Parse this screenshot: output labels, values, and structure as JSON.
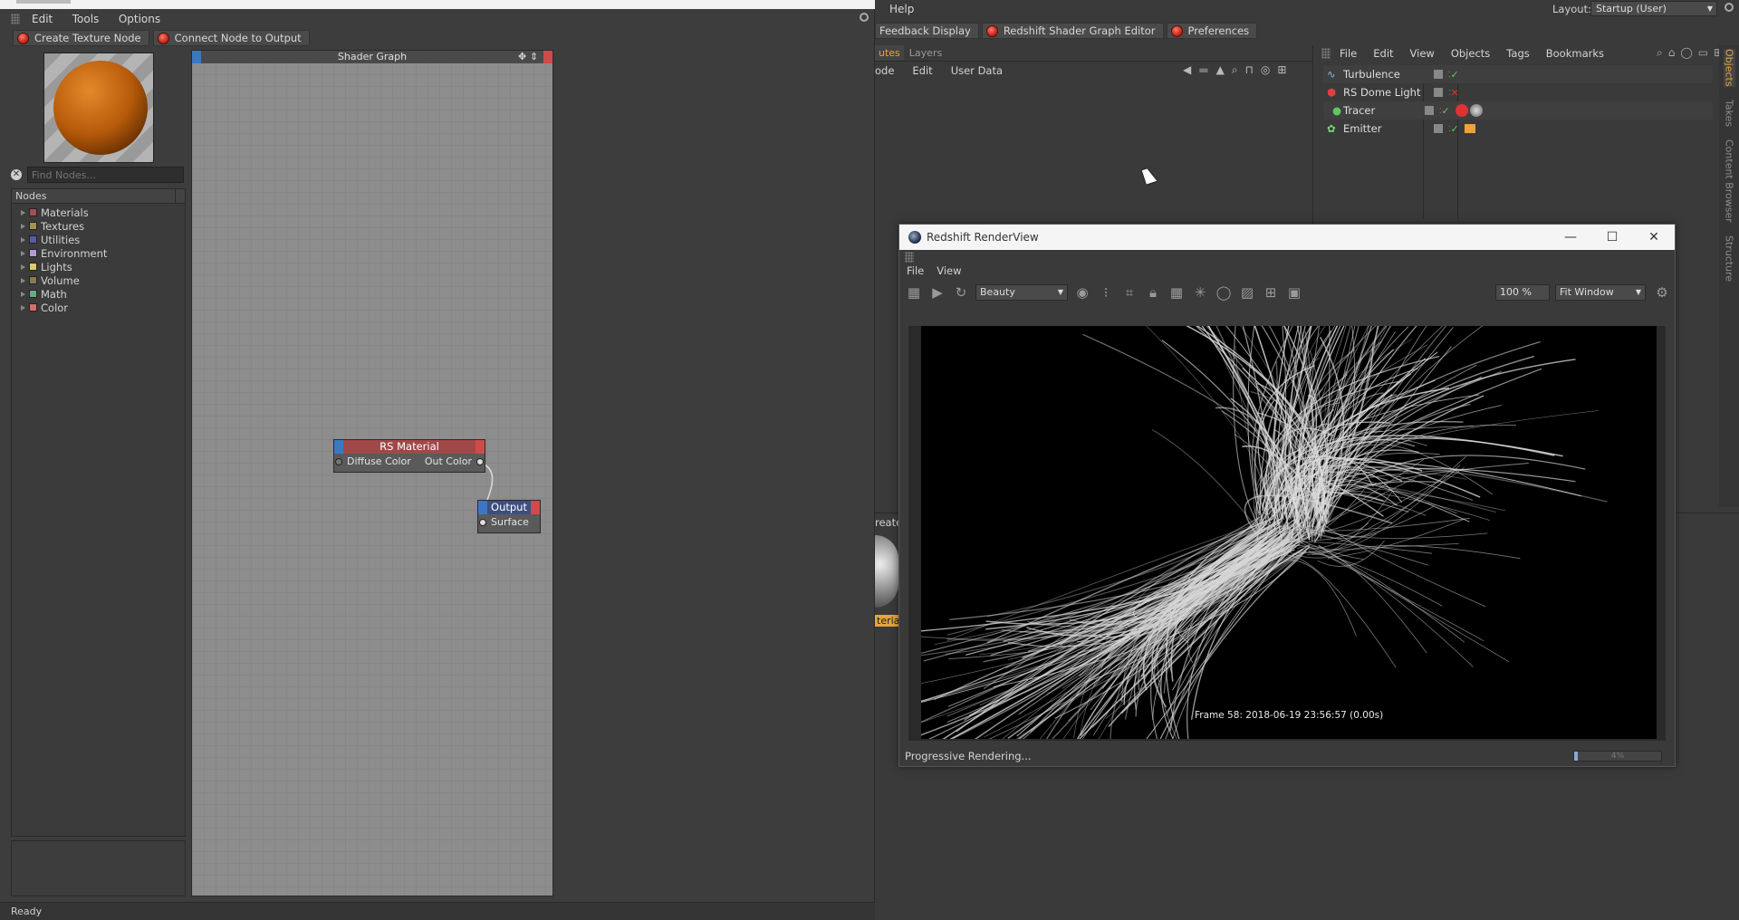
{
  "left_menu": [
    "Edit",
    "Tools",
    "Options"
  ],
  "toolbar": {
    "create_texture": "Create Texture Node",
    "connect_output": "Connect Node to Output"
  },
  "find_nodes": {
    "placeholder": "Find Nodes..."
  },
  "nodes_panel": {
    "header": "Nodes",
    "categories": [
      {
        "label": "Materials",
        "color": "#a05050"
      },
      {
        "label": "Textures",
        "color": "#a09450"
      },
      {
        "label": "Utilities",
        "color": "#5a5aa8"
      },
      {
        "label": "Environment",
        "color": "#b49ad0"
      },
      {
        "label": "Lights",
        "color": "#e0c870"
      },
      {
        "label": "Volume",
        "color": "#857a50"
      },
      {
        "label": "Math",
        "color": "#6aaa80"
      },
      {
        "label": "Color",
        "color": "#d07070"
      }
    ]
  },
  "shader_graph": {
    "title": "Shader Graph",
    "rs_material": {
      "title": "RS Material",
      "in_port": "Diffuse Color",
      "out_port": "Out Color"
    },
    "output": {
      "title": "Output",
      "in_port": "Surface"
    }
  },
  "status_bar": {
    "text": "Ready"
  },
  "top_right": {
    "help": "Help",
    "layout_label": "Layout:",
    "layout_value": "Startup (User)"
  },
  "tabs": {
    "feedback": "Feedback Display",
    "shader_editor": "Redshift Shader Graph Editor",
    "preferences": "Preferences"
  },
  "attributes": {
    "tab_partial": "utes",
    "layers_tab": "Layers",
    "menu": [
      "ode",
      "Edit",
      "User Data"
    ]
  },
  "objects_panel": {
    "menu": [
      "File",
      "Edit",
      "View",
      "Objects",
      "Tags",
      "Bookmarks"
    ],
    "objects": [
      {
        "name": "Turbulence",
        "state": "check"
      },
      {
        "name": "RS Dome Light",
        "state": "cross"
      },
      {
        "name": "Tracer",
        "state": "check"
      },
      {
        "name": "Emitter",
        "state": "check"
      }
    ]
  },
  "side_tabs": [
    "Objects",
    "Takes",
    "Content Browser",
    "Structure"
  ],
  "material_partial": {
    "create": "reate",
    "label": "terial"
  },
  "renderview": {
    "title": "Redshift RenderView",
    "menu": [
      "File",
      "View"
    ],
    "aov": "Beauty",
    "zoom": "100 %",
    "fit": "Fit Window",
    "overlay": "Frame  58:  2018-06-19  23:56:57  (0.00s)",
    "status": "Progressive Rendering...",
    "progress_label": "4%",
    "progress": 0.04
  },
  "colors": {
    "accent": "#e8a53a",
    "panel": "#3a3a3a",
    "graph": "#8d8d8d"
  }
}
